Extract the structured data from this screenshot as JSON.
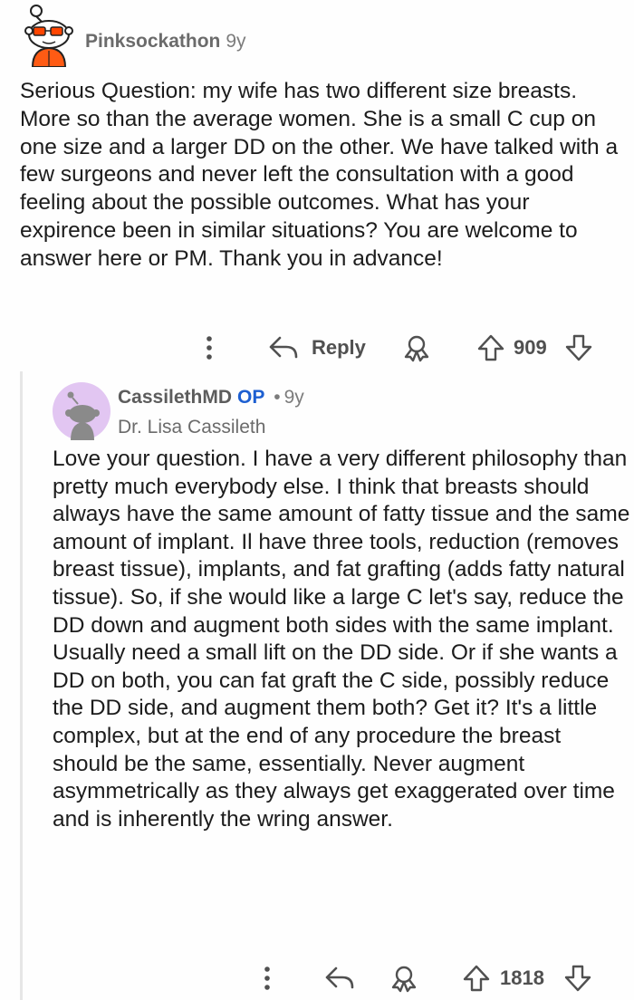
{
  "comment": {
    "author": "Pinksockathon",
    "age": "9y",
    "body": "Serious Question: my wife has two different size breasts. More so than the average women. She is a small C cup on one size and a larger DD on the other. We have talked with a few surgeons and never left the consultation with a good feeling about the possible outcomes. What has your expirence been in similar situations? You are welcome to answer here or PM. Thank you in advance!",
    "reply_label": "Reply",
    "vote_count": "909",
    "icons": {
      "avatar": "snoo-avatar-icon",
      "more": "more-options-icon",
      "reply": "reply-arrow-icon",
      "award": "award-icon",
      "upvote": "upvote-icon",
      "downvote": "downvote-icon"
    }
  },
  "reply": {
    "author": "CassilethMD",
    "op_badge": "OP",
    "separator": "•",
    "age": "9y",
    "flair": "Dr. Lisa Cassileth",
    "body": "Love your question. I have a very different philosophy than pretty much everybody else. I think that breasts should always have the same amount of fatty tissue and the same amount of implant. Il have three tools, reduction (removes breast tissue), implants, and fat grafting (adds fatty natural tissue). So, if she would like a large C let's say, reduce the DD down and augment both sides with the same implant. Usually need a small lift on the DD side. Or if she wants a DD on both, you can fat graft the C side, possibly reduce the DD side, and augment them both? Get it? It's a little complex, but at the end of any procedure the breast should be the same, essentially. Never augment asymmetrically as they always get exaggerated over time and is inherently the wring answer.",
    "vote_count": "1818"
  },
  "colors": {
    "op_badge": "#1d5fd1",
    "avatar_bg": "#e2c6f2",
    "icon_gray": "#505050"
  }
}
